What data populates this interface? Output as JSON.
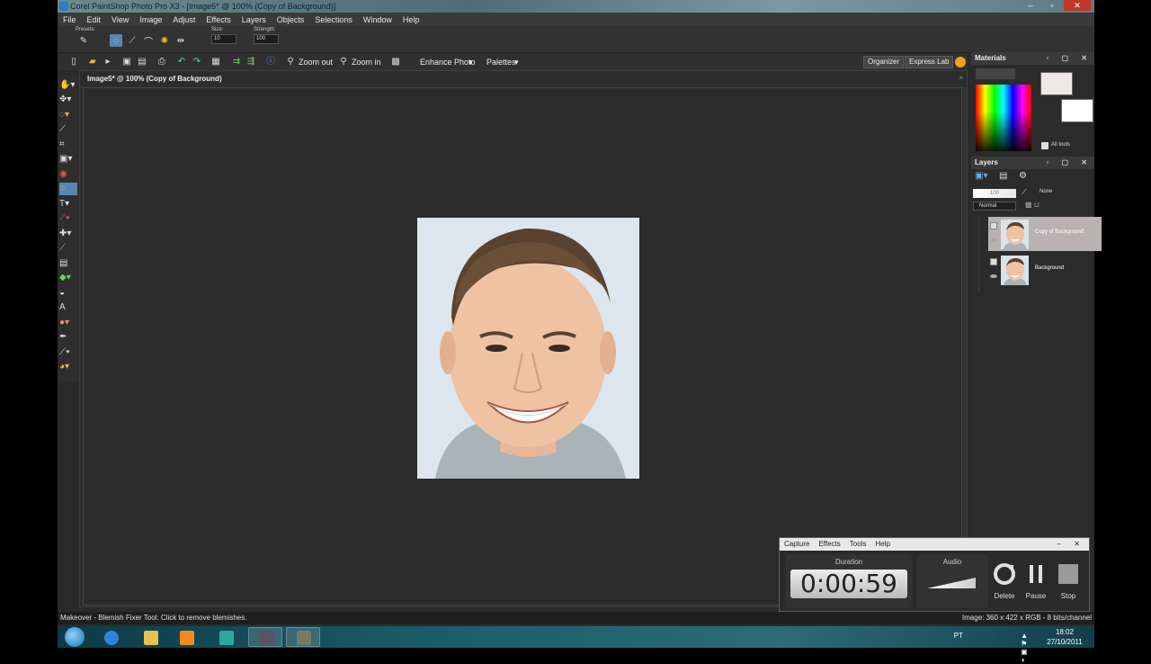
{
  "titlebar": {
    "title": "Corel PaintShop Photo Pro X3 - [Image5* @ 100% (Copy of Background)]",
    "controls": [
      "–",
      "▫",
      "✕"
    ]
  },
  "menu": [
    "File",
    "Edit",
    "View",
    "Image",
    "Adjust",
    "Effects",
    "Layers",
    "Objects",
    "Selections",
    "Window",
    "Help"
  ],
  "tool_options": {
    "presets_label": "Presets:",
    "size_label": "Size:",
    "size_value": "10",
    "strength_label": "Strength:",
    "strength_value": "100"
  },
  "standard_toolbar": {
    "zoom_out": "Zoom out",
    "zoom_in": "Zoom in",
    "enhance_photo": "Enhance Photo",
    "palettes": "Palettes",
    "organizer": "Organizer",
    "express_lab": "Express Lab"
  },
  "document": {
    "tab_title": "Image5* @ 100% (Copy of Background)",
    "close": "×"
  },
  "materials": {
    "title": "Materials",
    "all_tools": "All tools",
    "head_controls": "▫ ▢ ✕",
    "fg_color": "#f0e8e8",
    "bg_color": "#ffffff"
  },
  "layers": {
    "title": "Layers",
    "head_controls": "▫ ▢ ✕",
    "opacity": "100",
    "blend_mode": "Normal",
    "mask": "None",
    "items": [
      {
        "name": "Copy of Background",
        "selected": true
      },
      {
        "name": "Background",
        "selected": false
      }
    ]
  },
  "status": {
    "left": "Makeover - Blemish Fixer Tool: Click to remove blemishes.",
    "right": "Image: 360 x 422 x RGB - 8 bits/channel"
  },
  "recorder": {
    "menu": [
      "Capture",
      "Effects",
      "Tools",
      "Help"
    ],
    "controls": "– ✕",
    "duration_label": "Duration",
    "duration": "0:00:59",
    "audio_label": "Audio",
    "buttons": [
      "Delete",
      "Pause",
      "Stop"
    ]
  },
  "taskbar": {
    "lang": "PT",
    "time": "18:02",
    "date": "27/10/2011",
    "tray_icons": "▲ ⚑ ▣ ◖"
  }
}
